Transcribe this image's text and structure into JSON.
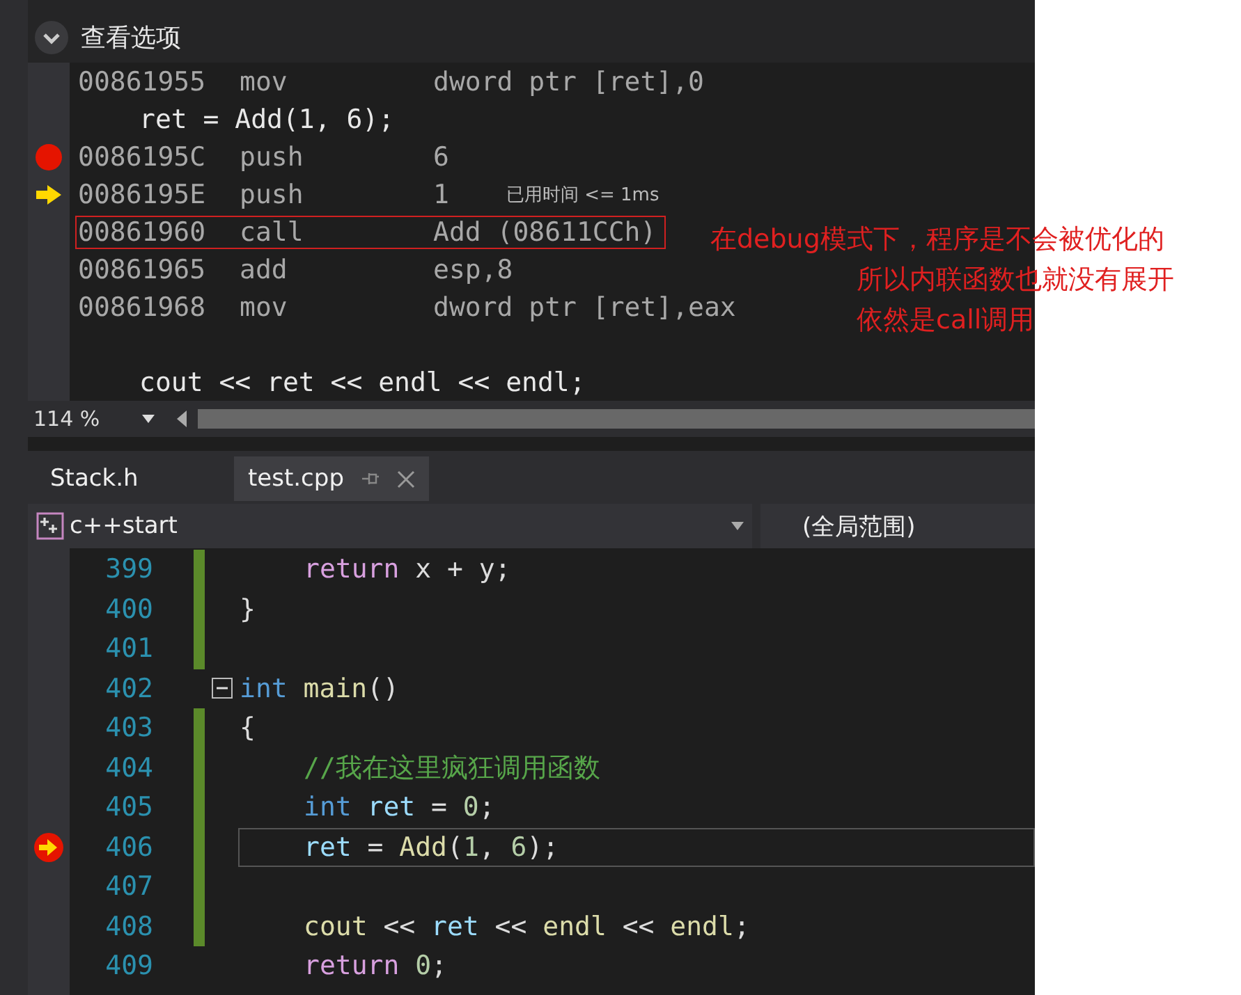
{
  "options_bar": {
    "label": "查看选项"
  },
  "disassembly": {
    "lines": [
      {
        "kind": "asm",
        "address": "00861955",
        "op": "mov",
        "operand": "dword ptr [ret],0",
        "breakpoint": false,
        "current": false,
        "highlighted": false
      },
      {
        "kind": "source",
        "text": "ret = Add(1, 6);"
      },
      {
        "kind": "asm",
        "address": "0086195C",
        "op": "push",
        "operand": "6",
        "breakpoint": true,
        "current": false,
        "highlighted": false
      },
      {
        "kind": "asm",
        "address": "0086195E",
        "op": "push",
        "operand": "1",
        "breakpoint": false,
        "current": true,
        "highlighted": false,
        "perf_tip": "已用时间 <= 1ms"
      },
      {
        "kind": "asm",
        "address": "00861960",
        "op": "call",
        "operand": "Add (08611CCh)",
        "breakpoint": false,
        "current": false,
        "highlighted": true
      },
      {
        "kind": "asm",
        "address": "00861965",
        "op": "add",
        "operand": "esp,8",
        "breakpoint": false,
        "current": false,
        "highlighted": false
      },
      {
        "kind": "asm",
        "address": "00861968",
        "op": "mov",
        "operand": "dword ptr [ret],eax",
        "breakpoint": false,
        "current": false,
        "highlighted": false
      },
      {
        "kind": "blank"
      },
      {
        "kind": "source",
        "text": "cout << ret << endl << endl;"
      }
    ],
    "zoom": "114 %"
  },
  "annotation": [
    "在debug模式下，程序是不会被优化的",
    "所以内联函数也就没有展开",
    "依然是call调用"
  ],
  "tabs": [
    {
      "label": "Stack.h",
      "selected": false
    },
    {
      "label": "test.cpp",
      "selected": true
    }
  ],
  "navigation": {
    "project": "c++start",
    "scope": "(全局范围)"
  },
  "code": [
    {
      "number": "399",
      "changed": true,
      "collapsible": false,
      "breakpoint": false,
      "current": false,
      "tokens": [
        {
          "kind": "indent"
        },
        {
          "t": "return",
          "kind": "control"
        },
        {
          "t": " x + y;",
          "kind": "plain"
        }
      ]
    },
    {
      "number": "400",
      "changed": true,
      "collapsible": false,
      "breakpoint": false,
      "current": false,
      "tokens": [
        {
          "t": "}",
          "kind": "plain"
        }
      ]
    },
    {
      "number": "401",
      "changed": true,
      "collapsible": false,
      "breakpoint": false,
      "current": false
    },
    {
      "number": "402",
      "changed": false,
      "collapsible": true,
      "breakpoint": false,
      "current": false,
      "tokens": [
        {
          "t": "int ",
          "kind": "keyword"
        },
        {
          "t": "main",
          "kind": "function"
        },
        {
          "t": "()",
          "kind": "plain"
        }
      ]
    },
    {
      "number": "403",
      "changed": true,
      "collapsible": false,
      "breakpoint": false,
      "current": false,
      "tokens": [
        {
          "t": "{",
          "kind": "plain"
        }
      ]
    },
    {
      "number": "404",
      "changed": true,
      "collapsible": false,
      "breakpoint": false,
      "current": false,
      "tokens": [
        {
          "kind": "indent"
        },
        {
          "t": "//我在这里疯狂调用函数",
          "kind": "comment"
        }
      ]
    },
    {
      "number": "405",
      "changed": true,
      "collapsible": false,
      "breakpoint": false,
      "current": false,
      "tokens": [
        {
          "kind": "indent"
        },
        {
          "t": "int ",
          "kind": "keyword"
        },
        {
          "t": "ret",
          "kind": "variable"
        },
        {
          "t": " = ",
          "kind": "plain"
        },
        {
          "t": "0",
          "kind": "number"
        },
        {
          "t": ";",
          "kind": "plain"
        }
      ]
    },
    {
      "number": "406",
      "changed": true,
      "collapsible": false,
      "breakpoint": true,
      "current": true,
      "tokens": [
        {
          "kind": "indent"
        },
        {
          "t": "ret",
          "kind": "variable"
        },
        {
          "t": " = ",
          "kind": "plain"
        },
        {
          "t": "Add",
          "kind": "function"
        },
        {
          "t": "(",
          "kind": "plain"
        },
        {
          "t": "1",
          "kind": "number"
        },
        {
          "t": ", ",
          "kind": "plain"
        },
        {
          "t": "6",
          "kind": "number"
        },
        {
          "t": ");",
          "kind": "plain"
        }
      ]
    },
    {
      "number": "407",
      "changed": true,
      "collapsible": false,
      "breakpoint": false,
      "current": false
    },
    {
      "number": "408",
      "changed": true,
      "collapsible": false,
      "breakpoint": false,
      "current": false,
      "tokens": [
        {
          "kind": "indent"
        },
        {
          "t": "cout",
          "kind": "function"
        },
        {
          "t": " << ",
          "kind": "plain"
        },
        {
          "t": "ret",
          "kind": "variable"
        },
        {
          "t": " << ",
          "kind": "plain"
        },
        {
          "t": "endl",
          "kind": "function"
        },
        {
          "t": " << ",
          "kind": "plain"
        },
        {
          "t": "endl",
          "kind": "function"
        },
        {
          "t": ";",
          "kind": "plain"
        }
      ]
    },
    {
      "number": "409",
      "changed": false,
      "collapsible": false,
      "breakpoint": false,
      "current": false,
      "tokens": [
        {
          "kind": "indent"
        },
        {
          "t": "return ",
          "kind": "control"
        },
        {
          "t": "0",
          "kind": "number"
        },
        {
          "t": ";",
          "kind": "plain"
        }
      ]
    }
  ]
}
